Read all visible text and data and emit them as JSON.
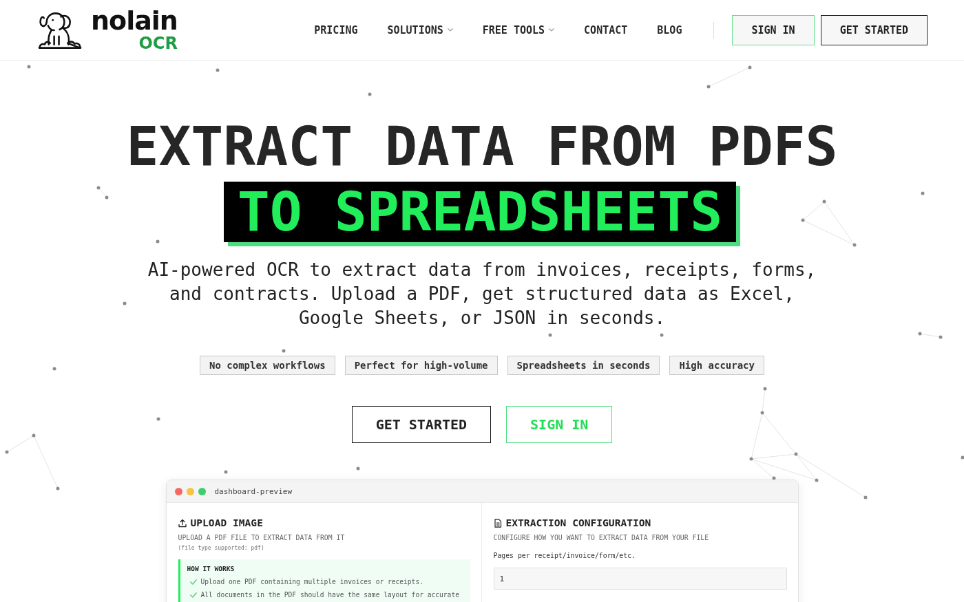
{
  "header": {
    "logo": {
      "name": "nolain",
      "product": "OCR"
    },
    "nav": [
      {
        "label": "PRICING",
        "dropdown": false
      },
      {
        "label": "SOLUTIONS",
        "dropdown": true
      },
      {
        "label": "FREE TOOLS",
        "dropdown": true
      },
      {
        "label": "CONTACT",
        "dropdown": false
      },
      {
        "label": "BLOG",
        "dropdown": false
      }
    ],
    "buttons": [
      {
        "label": "SIGN IN",
        "kind": "accent"
      },
      {
        "label": "GET STARTED",
        "kind": "outline"
      }
    ]
  },
  "hero": {
    "title": "EXTRACT DATA FROM PDFS",
    "highlight": "TO SPREADSHEETS",
    "description": "AI-powered OCR to extract data from invoices, receipts, forms, and contracts. Upload a PDF, get structured data as Excel, Google Sheets, or JSON in seconds.",
    "tags": [
      "No complex workflows",
      "Perfect for high-volume",
      "Spreadsheets in seconds",
      "High accuracy"
    ],
    "buttons": [
      {
        "label": "GET STARTED",
        "kind": "outline"
      },
      {
        "label": "SIGN IN",
        "kind": "accent"
      }
    ]
  },
  "preview": {
    "window_title": "dashboard-preview",
    "upload": {
      "title": "UPLOAD IMAGE",
      "subtitle": "UPLOAD A PDF FILE TO EXTRACT DATA FROM IT",
      "note": "(file type supported: pdf)",
      "how_it_works": {
        "title": "HOW IT WORKS",
        "steps": [
          "Upload one PDF containing multiple invoices or receipts.",
          "All documents in the PDF should have the same layout for accurate"
        ]
      }
    },
    "config": {
      "title": "EXTRACTION CONFIGURATION",
      "subtitle": "CONFIGURE HOW YOU WANT TO EXTRACT DATA FROM YOUR FILE",
      "field": {
        "label": "Pages per receipt/invoice/form/etc.",
        "value": "1"
      }
    }
  }
}
